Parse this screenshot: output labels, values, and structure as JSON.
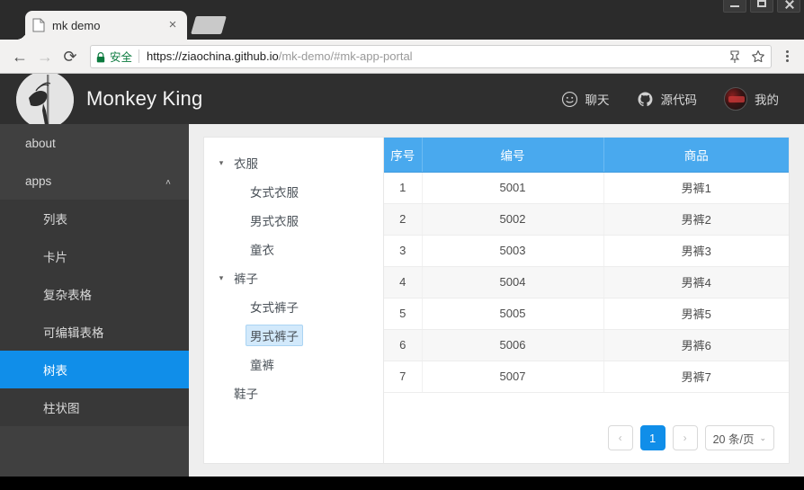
{
  "browser": {
    "tab": {
      "title": "mk demo",
      "favicon": "page-icon",
      "close": "×"
    },
    "nav": {
      "back": "←",
      "forward": "→",
      "reload": "⟳"
    },
    "omnibox": {
      "secure_label": "安全",
      "lock": "lock-icon",
      "url_strong": "https://ziaochina.github.io",
      "url_dim": "/mk-demo/#mk-app-portal"
    },
    "actions": {
      "save_icon": "pin-icon",
      "bookmark_icon": "star-icon",
      "menu_icon": "kebab-menu-icon"
    },
    "window_controls": {
      "minimize": "minimize",
      "maximize": "maximize",
      "close": "close"
    }
  },
  "app": {
    "header": {
      "logo": "monkey-king-logo",
      "title": "Monkey King",
      "actions": [
        {
          "icon": "smiley-chat-icon",
          "label": "聊天"
        },
        {
          "icon": "github-icon",
          "label": "源代码"
        },
        {
          "icon": "user-avatar",
          "label": "我的"
        }
      ]
    },
    "sidebar": {
      "top_items": [
        {
          "label": "about",
          "active": false
        },
        {
          "label": "apps",
          "active": false,
          "arrow": "˅"
        }
      ],
      "sub_items": [
        {
          "label": "列表",
          "active": false
        },
        {
          "label": "卡片",
          "active": false
        },
        {
          "label": "复杂表格",
          "active": false
        },
        {
          "label": "可编辑表格",
          "active": false
        },
        {
          "label": "树表",
          "active": true
        },
        {
          "label": "柱状图",
          "active": false
        }
      ]
    },
    "tree": {
      "nodes": [
        {
          "label": "衣服",
          "level": 0,
          "caret": "▾",
          "selected": false
        },
        {
          "label": "女式衣服",
          "level": 1,
          "caret": "",
          "selected": false
        },
        {
          "label": "男式衣服",
          "level": 1,
          "caret": "",
          "selected": false
        },
        {
          "label": "童衣",
          "level": 1,
          "caret": "",
          "selected": false
        },
        {
          "label": "裤子",
          "level": 0,
          "caret": "▾",
          "selected": false
        },
        {
          "label": "女式裤子",
          "level": 1,
          "caret": "",
          "selected": false
        },
        {
          "label": "男式裤子",
          "level": 1,
          "caret": "",
          "selected": true
        },
        {
          "label": "童裤",
          "level": 1,
          "caret": "",
          "selected": false
        },
        {
          "label": "鞋子",
          "level": 0,
          "caret": "",
          "selected": false
        }
      ]
    },
    "table": {
      "columns": [
        "序号",
        "编号",
        "商品"
      ],
      "rows": [
        [
          "1",
          "5001",
          "男裤1"
        ],
        [
          "2",
          "5002",
          "男裤2"
        ],
        [
          "3",
          "5003",
          "男裤3"
        ],
        [
          "4",
          "5004",
          "男裤4"
        ],
        [
          "5",
          "5005",
          "男裤5"
        ],
        [
          "6",
          "5006",
          "男裤6"
        ],
        [
          "7",
          "5007",
          "男裤7"
        ]
      ]
    },
    "pagination": {
      "prev": "‹",
      "next": "›",
      "pages": [
        "1"
      ],
      "current_page": "1",
      "page_size_label": "20 条/页",
      "chevron": "⌄"
    }
  },
  "colors": {
    "accent": "#108ee9",
    "table_header": "#49a9ee",
    "sidebar_bg": "#404040",
    "submenu_bg": "#383838",
    "header_bg": "#2f2f2f",
    "tree_selected_bg": "#d2e9fb",
    "secure_green": "#0b7a3e"
  }
}
